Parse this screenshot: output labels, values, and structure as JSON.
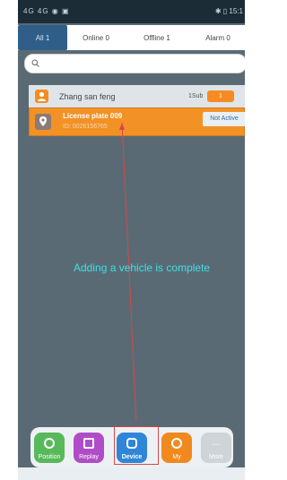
{
  "status_bar": {
    "left": "4G 4G  ◉ ▣",
    "right": "✱ ▯ 15:1"
  },
  "tabs": [
    {
      "label": "All 1"
    },
    {
      "label": "Online 0"
    },
    {
      "label": "Offline 1"
    },
    {
      "label": "Alarm 0"
    }
  ],
  "search": {
    "placeholder": ""
  },
  "group": {
    "name": "Zhang san feng",
    "sub_count": "1Sub",
    "chip_value": "1"
  },
  "vehicle": {
    "name": "License plate 009",
    "id": "ID: 0026156765",
    "status": "Not Active"
  },
  "overlay": {
    "message": "Adding a vehicle is complete"
  },
  "dock": [
    {
      "label": "Position",
      "color": "#58b95b"
    },
    {
      "label": "Replay",
      "color": "#b04cc8"
    },
    {
      "label": "Device",
      "color": "#2f86d9"
    },
    {
      "label": "My",
      "color": "#f08a1e"
    },
    {
      "label": "More",
      "color": "#cfd4d8"
    }
  ]
}
